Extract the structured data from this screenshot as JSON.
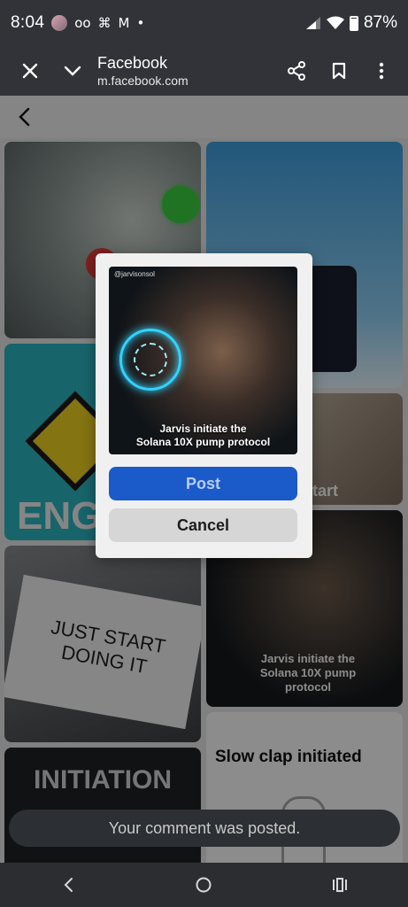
{
  "status_bar": {
    "time": "8:04",
    "battery": "87%",
    "voicemail_glyph": "oo",
    "pinwheel_glyph": "⌘",
    "gmail_glyph": "M",
    "dot": "•"
  },
  "browser": {
    "title": "Facebook",
    "url": "m.facebook.com"
  },
  "tiles": {
    "engage_text": "ENG",
    "just_start_text": "JUST START DOING IT",
    "start_text": "start",
    "jarvis_caption": "Jarvis initiate the Solana 10X pump protocol",
    "initiation_text": "INITIATION",
    "slow_clap_text": "Slow clap initiated"
  },
  "dialog": {
    "handle": "@jarvisonsol",
    "caption_line1": "Jarvis initiate the",
    "caption_line2": "Solana 10X pump protocol",
    "post_label": "Post",
    "cancel_label": "Cancel"
  },
  "toast": {
    "message": "Your comment was posted."
  },
  "icons": [
    "close-icon",
    "chevron-down-icon",
    "share-icon",
    "bookmark-icon",
    "more-vert-icon",
    "back-arrow-icon",
    "nav-back-icon",
    "nav-home-icon",
    "nav-recents-icon"
  ]
}
